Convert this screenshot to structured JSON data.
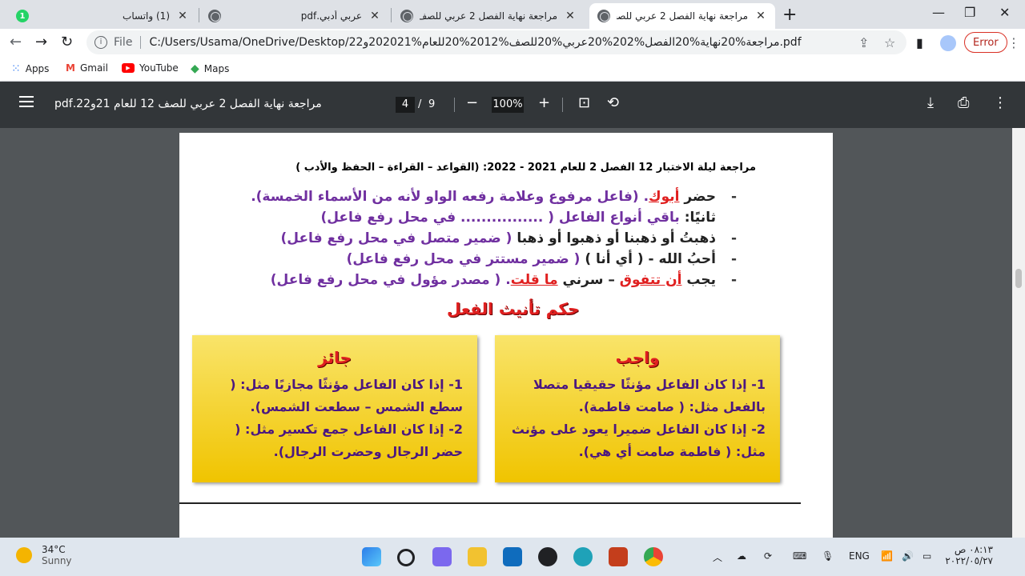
{
  "tabs": [
    {
      "title": "مراجعة نهاية الفصل 2 عربي للصف",
      "active": true
    },
    {
      "title": "مراجعة نهاية الفصل 2 عربي للصف",
      "active": false
    },
    {
      "title": "عربي أدبي.pdf",
      "active": false
    },
    {
      "title": "(1) واتساب",
      "active": false
    }
  ],
  "address": {
    "scheme": "File",
    "url": "C:/Users/Usama/OneDrive/Desktop/مراجعة%20نهاية%20الفصل%202%20عربي%20للصف%2012%20للعام%202021و22.pdf"
  },
  "error_label": "Error",
  "bookmarks": [
    "Apps",
    "Gmail",
    "YouTube",
    "Maps"
  ],
  "pdf": {
    "title": "مراجعة نهاية الفصل 2 عربي للصف 12 للعام 21و22.pdf",
    "page": "4",
    "slash": "/",
    "total": "9",
    "zoom": "100%"
  },
  "doc": {
    "header": "مراجعة ليلة الاختبار 12 الفصل 2 للعام 2021 - 2022: (القواعد – القراءة – الحفظ والأدب )",
    "l1a": "حضر ",
    "l1b": "أبوك",
    "l1c": ".           (فاعل مرفوع وعلامة رفعه الواو لأنه من الأسماء الخمسة).",
    "l2a": "ثانيًا: ",
    "l2b": "باقي أنواع الفاعل ( ................ في محل رفع فاعل)",
    "l3a": "ذهبتُ أو ذهبنا أو ذهبوا أو ذهبا",
    "l3b": "     ( ضمير متصل في محل رفع فاعل)",
    "l4a": "أحبُ الله  - ( أي أنا )",
    "l4b": "         ( ضمير مستتر في محل رفع فاعل)",
    "l5a": "يجب ",
    "l5b": "أن تتفوق",
    "l5c": " – سرني ",
    "l5d": "ما قلت",
    "l5e": ".       ( مصدر مؤول في محل رفع فاعل)",
    "dash": "-",
    "section_title": "حكم تأنيث الفعل",
    "box_must_title": "واجب",
    "box_must_1": "1- إذا كان الفاعل مؤنثًا حقيقيا متصلا بالفعل مثل: ( صامت فاطمة).",
    "box_must_2": "2- إذا كان الفاعل ضميرا يعود على مؤنث مثل: ( فاطمة صامت أي هي).",
    "box_may_title": "جائز",
    "box_may_1": "1- إذا كان الفاعل مؤنثًا مجازيًا مثل: ( سطع الشمس – سطعت الشمس).",
    "box_may_2": "2- إذا كان الفاعل جمع تكسير مثل: ( حضر الرجال وحضرت الرجال)."
  },
  "taskbar": {
    "temp": "34°C",
    "weather": "Sunny",
    "lang": "ENG",
    "time": "٠٨:١٣ ص",
    "date": "٢٠٢٢/٠٥/٢٧"
  },
  "colors": {
    "tab_bg": "#dee1e6",
    "pdf_toolbar": "#323639",
    "viewer_bg": "#525659",
    "box_yellow": "#f0c400",
    "accent_purple": "#7030a0",
    "accent_red": "#e02020"
  }
}
